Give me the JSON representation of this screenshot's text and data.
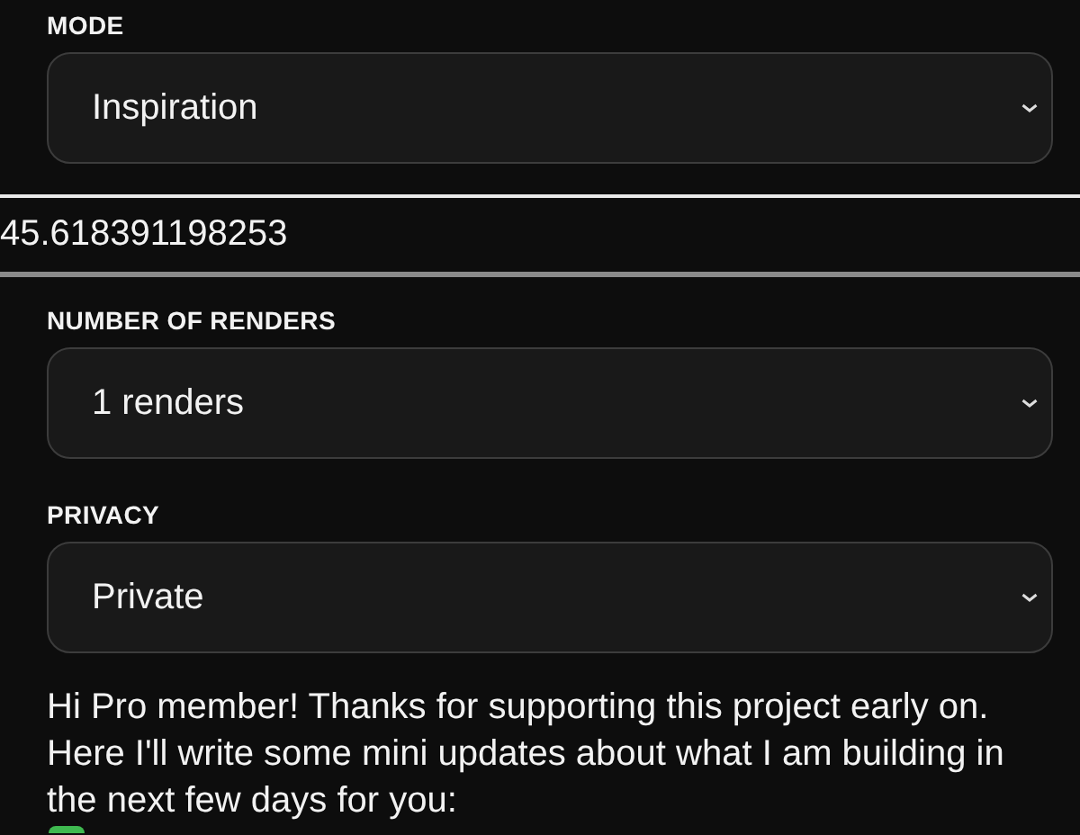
{
  "fields": [
    {
      "kind": "select",
      "label": "MODE",
      "value": "Inspiration"
    },
    {
      "kind": "input",
      "value": "45.618391198253"
    },
    {
      "kind": "select",
      "label": "NUMBER OF RENDERS",
      "value": "1 renders"
    },
    {
      "kind": "select",
      "label": "PRIVACY",
      "value": "Private"
    }
  ],
  "message": {
    "text": "Hi Pro member! Thanks for supporting this project early on. Here I'll write some mini updates about what I am building in the next few days for you:"
  }
}
